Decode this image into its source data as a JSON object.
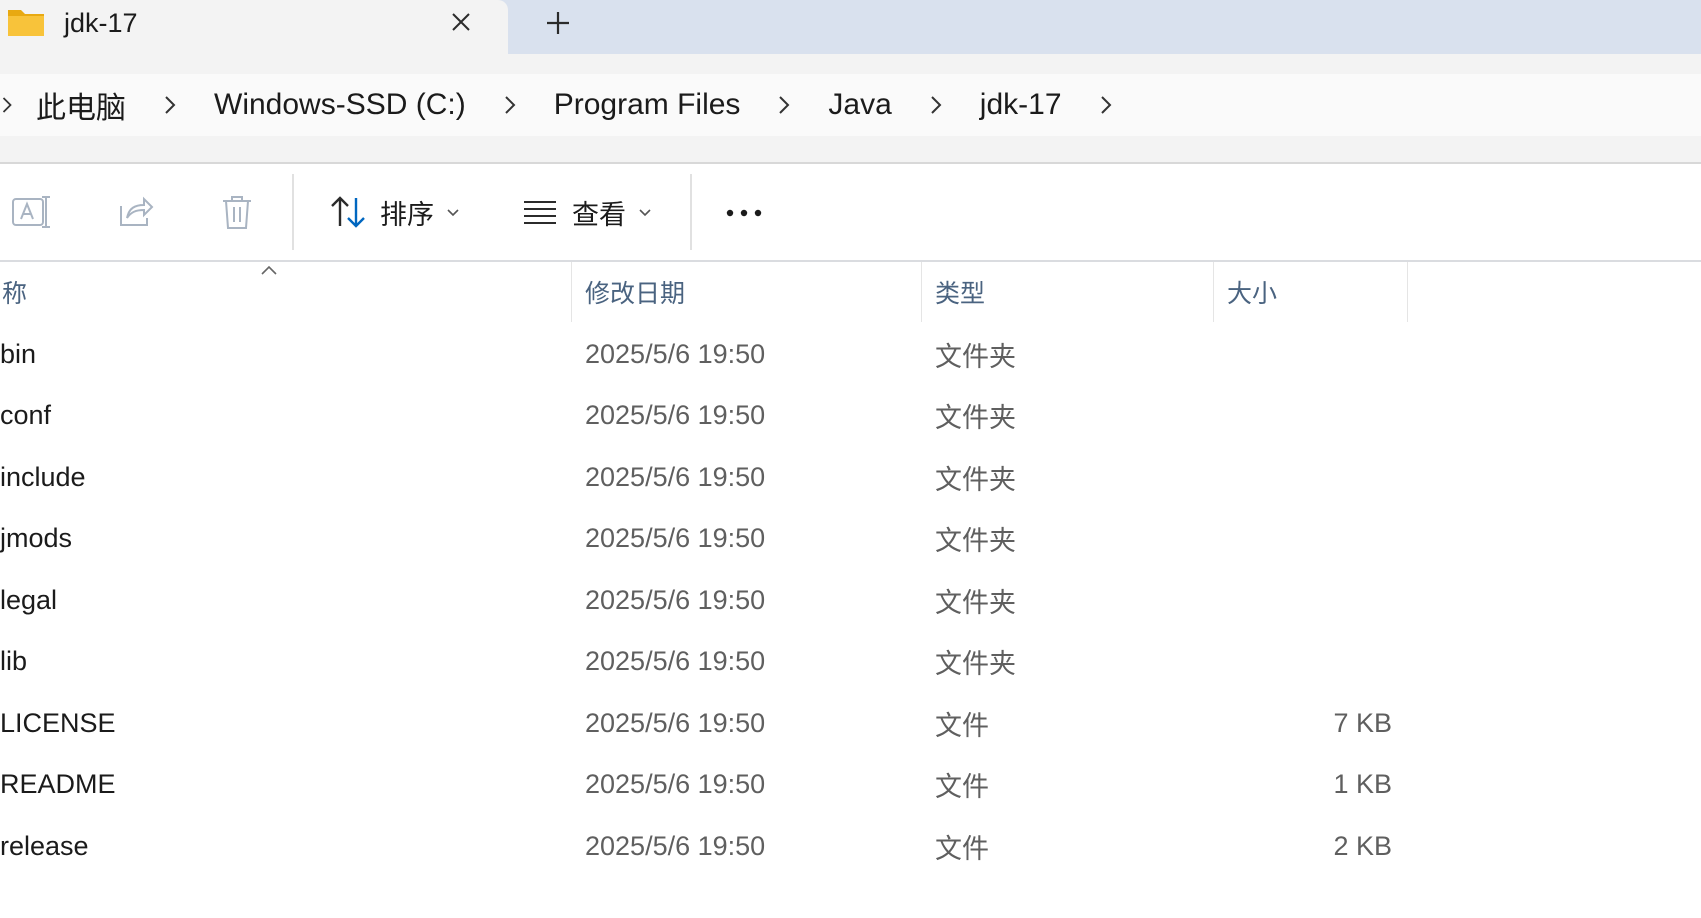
{
  "tab": {
    "title": "jdk-17"
  },
  "breadcrumbs": [
    "此电脑",
    "Windows-SSD (C:)",
    "Program Files",
    "Java",
    "jdk-17"
  ],
  "toolbar": {
    "sort_label": "排序",
    "view_label": "查看"
  },
  "columns": {
    "name": "称",
    "date": "修改日期",
    "type": "类型",
    "size": "大小"
  },
  "files": [
    {
      "name": "bin",
      "date": "2025/5/6 19:50",
      "type": "文件夹",
      "size": ""
    },
    {
      "name": "conf",
      "date": "2025/5/6 19:50",
      "type": "文件夹",
      "size": ""
    },
    {
      "name": "include",
      "date": "2025/5/6 19:50",
      "type": "文件夹",
      "size": ""
    },
    {
      "name": "jmods",
      "date": "2025/5/6 19:50",
      "type": "文件夹",
      "size": ""
    },
    {
      "name": "legal",
      "date": "2025/5/6 19:50",
      "type": "文件夹",
      "size": ""
    },
    {
      "name": "lib",
      "date": "2025/5/6 19:50",
      "type": "文件夹",
      "size": ""
    },
    {
      "name": "LICENSE",
      "date": "2025/5/6 19:50",
      "type": "文件",
      "size": "7 KB"
    },
    {
      "name": "README",
      "date": "2025/5/6 19:50",
      "type": "文件",
      "size": "1 KB"
    },
    {
      "name": "release",
      "date": "2025/5/6 19:50",
      "type": "文件",
      "size": "2 KB"
    }
  ],
  "colors": {
    "accent": "#0067c0",
    "tab_strip": "#d9e1ee",
    "folder": "#f8c33a"
  }
}
